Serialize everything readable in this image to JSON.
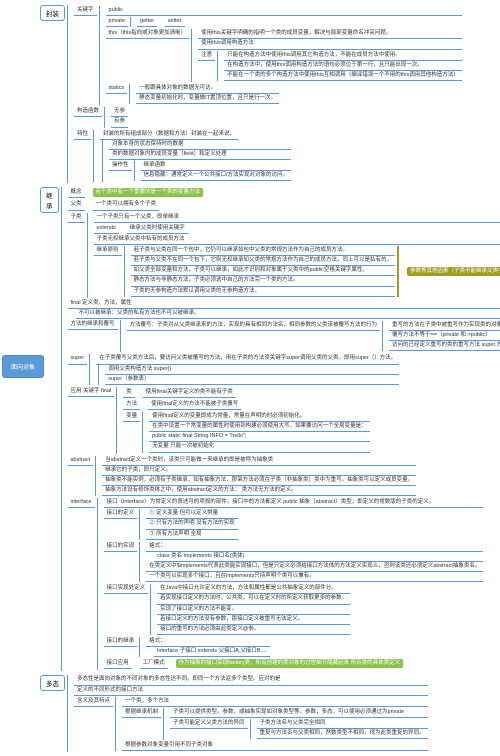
{
  "root": "面向对象",
  "encaps": {
    "title": "封装",
    "kw": {
      "title": "关键字",
      "public": "public",
      "private": {
        "title": "private",
        "getter": "getter",
        "setter": "setter"
      },
      "this": {
        "title": "this（this指向或对象更加清晰）",
        "n1": "使用this关键字明确的指明一个类的成员变量，解决与局部变量命名冲突问题。",
        "n2": "使用this调用构造方法",
        "notes": {
          "title": "注意",
          "a": "只能在构造方法中使用this调用其它构造方法，不能在成员方法中使用。",
          "b": "在构造方法中，使用this调用构造方法的语句必须位于第一行，且只能出现一次。",
          "c": "不能在一个类的多个构造方法中使用this互相调用（编译错误一个不用的this调用其他构造方法）"
        }
      },
      "statics": {
        "title": "statics",
        "n1": "一般跟具体对象的数据无可访。",
        "n2": "静态变量初始化时，变量做IT置顶位置，且只是行一次。"
      }
    },
    "ctor": {
      "title": "构造函数",
      "noarg": "无参",
      "arg": "有参"
    },
    "feature": {
      "title": "特性",
      "text": "封装的所有组成部分（数据和方法）封装在一起来说。",
      "items": {
        "a": "对象本身的状态保持时的数据",
        "b": "类的数据对象内的成员变量（field）和定义处理",
        "c": {
          "title": "操作性",
          "n1": "继承函数",
          "n2": "信息隐藏：通常定义一个公共接口/方法实现对对象的访问。"
        }
      }
    }
  },
  "inherit": {
    "title": "继承",
    "concept": {
      "title": "概念",
      "hl": "若干类中有一个重要的是一个类的变量方法"
    },
    "parent": {
      "title": "父类",
      "text": "一个类可以拥有多个子类"
    },
    "child": {
      "title": "子类",
      "n1": "一个子类只有一个父类，即单继承",
      "extends": {
        "title": "extends",
        "n1": "继承父类时使用关键字"
      },
      "n2": "子类无权继承父类中私有的成员方法",
      "rules": {
        "title": "继承原则",
        "a": "若子类与父类在同一个包中，它仍可以继承如包中父类的常规方法作为自己的成员方法。",
        "b": "若子类与父类不在同一个包下，它则无权继承如父类的常规方法作为自己的成员方法。同上可以是私有的。",
        "c": "如父类全部变量和方法，子类可以继承，如此才识别和对象属于父类中的public空格关键字属性。",
        "d": "静态方法与非静态方法，子类必须选中自己的方法完一个类的方法。",
        "e": "子类的无参构造方法默认调用父类的无参构造方法。",
        "side": "参数等其他因素（子类不能继承父类中带Private的成员变量和方法）"
      }
    },
    "finalNote": "final 定义类、方法，属性",
    "cantInherit": "不可以被继承：父类的私有方法也不可以被继承。",
    "override": {
      "title": "方法的继承和覆写",
      "text": "方法覆写：子类对从父类继承来的方法，实现的具有相同方法名，相同参数的父类该被覆写方法的行为",
      "side": "重写的方法在子类中被重写作为实现类的对象命令，不能带有重新的对象知同类型",
      "notes": {
        "a": "覆写方法不等于==（private 和 >public）",
        "b": "访问的已经定义重写的类的重写方法     super.方法名();"
      }
    },
    "super": {
      "title": "super",
      "text": "在子类覆写父类方法后，要访问父类被覆写的方法，用在子类的方法须关键字super调用父类的父类。即用super（）方法。",
      "n1": "调用父类构造方法     super()",
      "n2": "super（参数表）"
    },
    "finalKw": {
      "title": "应用 关键字 final",
      "a": {
        "title": "类",
        "t": "使用final关键字定义的类不能有子类"
      },
      "b": {
        "title": "方法",
        "t": "使用final定义的方法不能被子类覆写"
      },
      "c": {
        "title": "变量",
        "t1": "使用final定义的变量即成为常量，常量在声明的时必须初始化。",
        "t2": "在类中设置一个常变量的属性时使用到构建必须使用大写，如果要访问一个全局变量是：",
        "t3": "public static final String INFO = \"hello\";",
        "t4": "无变量 只能一次被初始化"
      }
    },
    "abstractKw": {
      "title": "abstract",
      "n1": "当abstract定义一个类时，该类只可能做一来继承的即是被称为抽象类",
      "n2": "继承它的子类，即只定义。",
      "n3": "抽象类不能实例，必须有子类继承，如有抽象方法，那架方法必须在子类（非抽象类）类中为重写。抽象类可以定义成员变量。",
      "n4": "抽象方法设有修饰类体之中，使用abstract定义的方法： 类方法无方法的定义。"
    },
    "interfaceKw": {
      "title": "interface",
      "intro": "接口（interface）为常定义的表述可的项规的部件，接口中的方法都定义 public 抽象（abstract）类型，即定义的常数版的子类的定义。",
      "def": {
        "title": "接口的定义",
        "a": "① 定义变量 但可以定义常量",
        "b": "② 只有方法的声明 没有方法的实现",
        "c": "③ 所有方法声明 全局"
      },
      "impl": {
        "title": "接口的实现",
        "fmt": "格式：",
        "code": "class 类名 implements 接口名{类体}",
        "a": "在类定义中$implements代表此类能实现接口，但是只定义必须给接口方法体的方法定义实现么，否则该类还必须定义abstract抽象类名。",
        "b": "一个类可以实现多个接口，且在implements只持声明个类可以兼有。"
      },
      "extendImpl": {
        "title": "接口实现处定义",
        "a": "在Java中接口允许定义的方法，方法和属性都是公共抽象定义的部件分。",
        "b": "若实现接口定义的方法时，公共类，可以在定义时的所定义获取更多的参数。",
        "c": "实现了接口定义的方法不能变。",
        "d": "若接口定义的方法没有参数，那接口定义被重写无法定义。",
        "e": "接口的重写的方法必须由此类定义@参。"
      },
      "extend": {
        "title": "接口的继承",
        "fmt": "格式：",
        "code": "interface 子接口 extends 父接口A,父接口B,..."
      },
      "factory": {
        "title": "接口应用",
        "label": "工厂模式",
        "hl": "作为抽象的接口实现factory类，所有创建的类对象的过程细节隐藏起来 所有类的具体类定义"
      }
    }
  },
  "poly": {
    "title": "多态",
    "def": "多态性是面向对象的不同对象的多态性达不同。即同一个方法返多个类型。应对的是",
    "n1": "定义的不同形式的接口方法",
    "meaning": {
      "title": "含义及其特点",
      "a": {
        "title": "一个类，多个方法"
      },
      "b": {
        "title": "根据继承机制",
        "n1": "子类可以提供类型。参数，或抽象实现如对象类型等。参数，多态。可以使用必须通过为private",
        "n2": "子类可能定义父类方法的异同",
        "items": {
          "a": "子类方法名与父类完全相同",
          "b": "重复与方法名与父类相同，然数类型不相同，视为此类重复的异同。"
        }
      },
      "c": "根据参数对象变量引用不同子类对象"
    }
  }
}
